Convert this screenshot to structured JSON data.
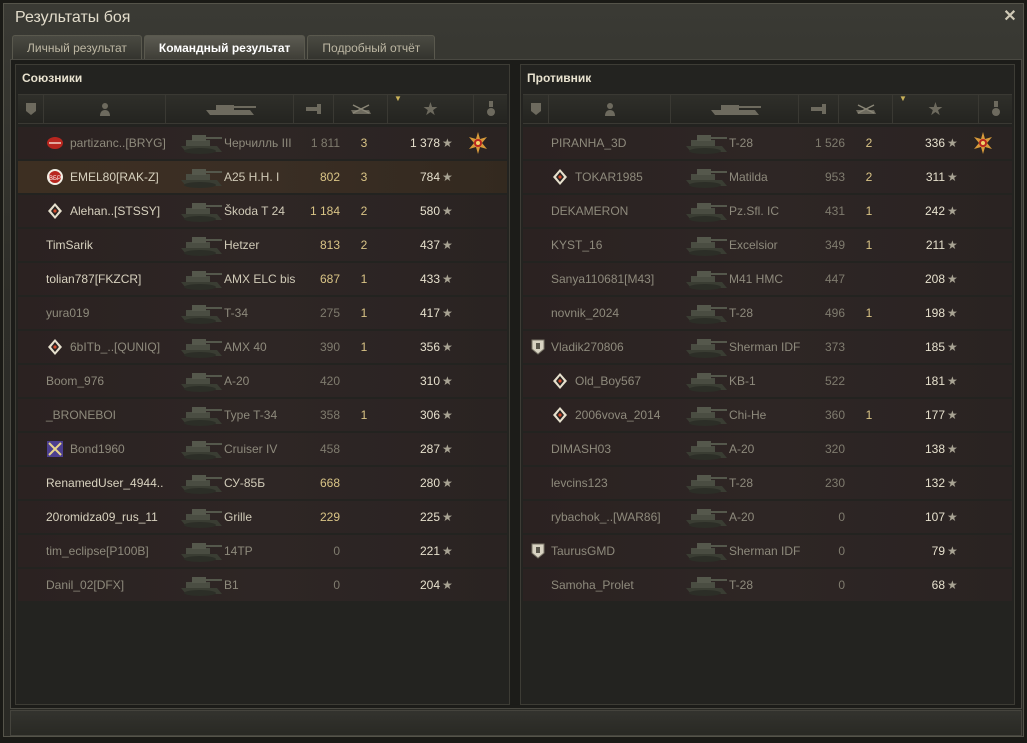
{
  "window": {
    "title": "Результаты боя",
    "close_label": "✕"
  },
  "tabs": [
    {
      "label": "Личный результат",
      "active": false
    },
    {
      "label": "Командный результат",
      "active": true
    },
    {
      "label": "Подробный отчёт",
      "active": false
    }
  ],
  "columns": [
    "squad",
    "player",
    "tank",
    "damage",
    "frags",
    "xp",
    "medal"
  ],
  "allies": {
    "title": "Союзники",
    "rows": [
      {
        "player": "partizanc..[BRYG]",
        "tank": "Черчилль III",
        "damage": "1 811",
        "frags": "3",
        "xp": "1 378",
        "icon": "red-mark",
        "medal": true,
        "dim": true
      },
      {
        "player": "EMEL80[RAK-Z]",
        "tank": "A25 H.H. I",
        "damage": "802",
        "frags": "3",
        "xp": "784",
        "icon": "vbr-badge",
        "highlight": true,
        "dmg_hl": true
      },
      {
        "player": "Alehan..[STSSY]",
        "tank": "Škoda T 24",
        "damage": "1 184",
        "frags": "2",
        "xp": "580",
        "icon": "diamond",
        "dmg_hl": true
      },
      {
        "player": "TimSarik",
        "tank": "Hetzer",
        "damage": "813",
        "frags": "2",
        "xp": "437",
        "dmg_hl": true
      },
      {
        "player": "tolian787[FKZCR]",
        "tank": "AMX ELC bis",
        "damage": "687",
        "frags": "1",
        "xp": "433",
        "dmg_hl": true
      },
      {
        "player": "yura019",
        "tank": "T-34",
        "damage": "275",
        "frags": "1",
        "xp": "417",
        "dim": true
      },
      {
        "player": "6bITb_..[QUNIQ]",
        "tank": "AMX 40",
        "damage": "390",
        "frags": "1",
        "xp": "356",
        "icon": "diamond",
        "dim": true
      },
      {
        "player": "Boom_976",
        "tank": "A-20",
        "damage": "420",
        "frags": "",
        "xp": "310",
        "dim": true
      },
      {
        "player": "_BRONEBOI",
        "tank": "Type T-34",
        "damage": "358",
        "frags": "1",
        "xp": "306",
        "dim": true
      },
      {
        "player": "Bond1960",
        "tank": "Cruiser IV",
        "damage": "458",
        "frags": "",
        "xp": "287",
        "icon": "clan-emblem",
        "dim": true
      },
      {
        "player": "RenamedUser_4944..",
        "tank": "СУ-85Б",
        "damage": "668",
        "frags": "",
        "xp": "280",
        "dmg_hl": true
      },
      {
        "player": "20romidza09_rus_11",
        "tank": "Grille",
        "damage": "229",
        "frags": "",
        "xp": "225",
        "dmg_hl": true
      },
      {
        "player": "tim_eclipse[P100B]",
        "tank": "14TP",
        "damage": "0",
        "frags": "",
        "xp": "221",
        "dim": true
      },
      {
        "player": "Danil_02[DFX]",
        "tank": "B1",
        "damage": "0",
        "frags": "",
        "xp": "204",
        "dim": true
      }
    ]
  },
  "enemies": {
    "title": "Противник",
    "rows": [
      {
        "player": "PIRANHA_3D",
        "tank": "T-28",
        "damage": "1 526",
        "frags": "2",
        "xp": "336",
        "medal": true,
        "dim": true
      },
      {
        "player": "TOKAR1985",
        "tank": "Matilda",
        "damage": "953",
        "frags": "2",
        "xp": "311",
        "icon": "diamond",
        "dim": true
      },
      {
        "player": "DEKAMERON",
        "tank": "Pz.Sfl. IC",
        "damage": "431",
        "frags": "1",
        "xp": "242",
        "dim": true
      },
      {
        "player": "KYST_16",
        "tank": "Excelsior",
        "damage": "349",
        "frags": "1",
        "xp": "211",
        "dim": true
      },
      {
        "player": "Sanya110681[M43]",
        "tank": "M41 HMC",
        "damage": "447",
        "frags": "",
        "xp": "208",
        "dim": true
      },
      {
        "player": "novnik_2024",
        "tank": "T-28",
        "damage": "496",
        "frags": "1",
        "xp": "198",
        "dim": true
      },
      {
        "player": "Vladik270806",
        "tank": "Sherman IDF",
        "damage": "373",
        "frags": "",
        "xp": "185",
        "squad": true,
        "dim": true
      },
      {
        "player": "Old_Boy567",
        "tank": "KB-1",
        "damage": "522",
        "frags": "",
        "xp": "181",
        "icon": "diamond",
        "dim": true
      },
      {
        "player": "2006vova_2014",
        "tank": "Chi-He",
        "damage": "360",
        "frags": "1",
        "xp": "177",
        "icon": "diamond",
        "dim": true
      },
      {
        "player": "DIMASH03",
        "tank": "A-20",
        "damage": "320",
        "frags": "",
        "xp": "138",
        "dim": true
      },
      {
        "player": "levcins123",
        "tank": "T-28",
        "damage": "230",
        "frags": "",
        "xp": "132",
        "dim": true
      },
      {
        "player": "rybachok_..[WAR86]",
        "tank": "A-20",
        "damage": "0",
        "frags": "",
        "xp": "107",
        "dim": true
      },
      {
        "player": "TaurusGMD",
        "tank": "Sherman IDF",
        "damage": "0",
        "frags": "",
        "xp": "79",
        "squad": true,
        "dim": true
      },
      {
        "player": "Samoha_Prolet",
        "tank": "T-28",
        "damage": "0",
        "frags": "",
        "xp": "68",
        "dim": true
      }
    ]
  },
  "icons": {
    "header": [
      "squad-icon",
      "player-icon",
      "tank-icon",
      "damage-icon",
      "frags-icon",
      "xp-star-icon",
      "medal-icon"
    ],
    "star": "★"
  },
  "colors": {
    "accent": "#d9c486",
    "row_bg": "#2e2625",
    "highlight_bg": "#3a2e24"
  }
}
